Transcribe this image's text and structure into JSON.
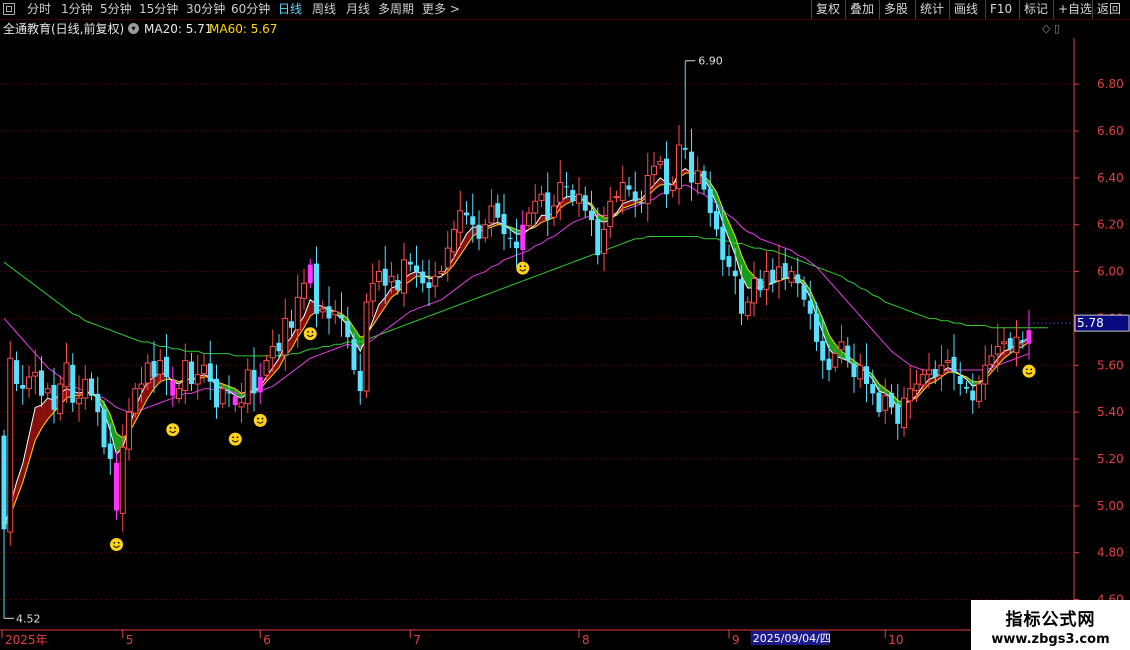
{
  "toolbar": {
    "periods": [
      "分时",
      "1分钟",
      "5分钟",
      "15分钟",
      "30分钟",
      "60分钟",
      "日线",
      "周线",
      "月线",
      "多周期"
    ],
    "active_period": "日线",
    "more_label": "更多 >",
    "right_buttons": [
      "复权",
      "叠加",
      "多股",
      "统计",
      "画线",
      "F10",
      "标记",
      "+自选",
      "返回"
    ]
  },
  "info": {
    "title": "全通教育(日线,前复权)",
    "ma20_label": "MA20: 5.71",
    "ma60_label": "MA60: 5.67",
    "icons": "◇ ▯"
  },
  "colors": {
    "up": "#ff4d4d",
    "down": "#57e0ff",
    "signal": "#ff33ff",
    "ma_white": "#ffffff",
    "ma_yellow": "#ffd800",
    "ma_magenta": "#e83ce8",
    "ma_green": "#2ecc2e",
    "axis": "#e04040"
  },
  "chart_data": {
    "type": "candlestick",
    "y_ticks": [
      "6.80",
      "6.60",
      "6.40",
      "6.20",
      "6.00",
      "5.80",
      "5.60",
      "5.40",
      "5.20",
      "5.00",
      "4.80",
      "4.60"
    ],
    "ylim": [
      4.47,
      6.98
    ],
    "x_labels": [
      {
        "label": "2025年",
        "index": 0
      },
      {
        "label": "5",
        "index": 19
      },
      {
        "label": "6",
        "index": 41
      },
      {
        "label": "7",
        "index": 65
      },
      {
        "label": "8",
        "index": 92
      },
      {
        "label": "9",
        "index": 116
      },
      {
        "label": "10",
        "index": 141
      }
    ],
    "cursor_date": "2025/09/04/四",
    "cursor_index": 119,
    "current_price": "5.78",
    "high_marker": {
      "label": "6.90",
      "value": 6.9,
      "index": 109
    },
    "low_marker": {
      "label": "4.52",
      "value": 4.52,
      "index": 0
    },
    "closes": [
      4.9,
      5.63,
      5.52,
      5.5,
      5.55,
      5.57,
      5.47,
      5.5,
      5.41,
      5.52,
      5.61,
      5.44,
      5.46,
      5.54,
      5.47,
      5.4,
      5.25,
      5.2,
      4.98,
      5.25,
      5.4,
      5.5,
      5.52,
      5.61,
      5.55,
      5.62,
      5.55,
      5.47,
      5.5,
      5.62,
      5.52,
      5.56,
      5.6,
      5.53,
      5.42,
      5.5,
      5.48,
      5.43,
      5.44,
      5.58,
      5.48,
      5.55,
      5.62,
      5.68,
      5.66,
      5.8,
      5.76,
      5.89,
      5.95,
      6.03,
      5.82,
      5.84,
      5.8,
      5.83,
      5.8,
      5.72,
      5.58,
      5.49,
      5.87,
      5.95,
      6.0,
      5.94,
      5.98,
      5.92,
      6.05,
      6.03,
      6.0,
      5.95,
      5.93,
      5.98,
      6.0,
      6.1,
      6.18,
      6.26,
      6.24,
      6.2,
      6.14,
      6.2,
      6.28,
      6.23,
      6.16,
      6.14,
      6.1,
      6.2,
      6.25,
      6.3,
      6.33,
      6.22,
      6.28,
      6.38,
      6.36,
      6.3,
      6.33,
      6.26,
      6.22,
      6.07,
      6.18,
      6.3,
      6.32,
      6.38,
      6.35,
      6.3,
      6.29,
      6.41,
      6.45,
      6.47,
      6.33,
      6.37,
      6.54,
      6.52,
      6.38,
      6.43,
      6.35,
      6.25,
      6.18,
      6.05,
      6.02,
      5.98,
      5.82,
      5.87,
      5.97,
      5.92,
      6.0,
      5.95,
      6.02,
      5.97,
      6.0,
      5.95,
      5.88,
      5.82,
      5.7,
      5.62,
      5.58,
      5.65,
      5.7,
      5.62,
      5.55,
      5.6,
      5.52,
      5.48,
      5.4,
      5.47,
      5.42,
      5.35,
      5.46,
      5.5,
      5.52,
      5.56,
      5.58,
      5.55,
      5.6,
      5.62,
      5.57,
      5.52,
      5.5,
      5.45,
      5.52,
      5.6,
      5.64,
      5.68,
      5.7,
      5.67,
      5.72,
      5.7,
      5.75
    ],
    "signal_indices": [
      18,
      27,
      37,
      41,
      49,
      83,
      164
    ],
    "ma_white": [
      4.9,
      5.0,
      5.1,
      5.18,
      5.3,
      5.42,
      5.43,
      5.46,
      5.45,
      5.48,
      5.5,
      5.49,
      5.48,
      5.49,
      5.48,
      5.46,
      5.4,
      5.32,
      5.22,
      5.25,
      5.33,
      5.42,
      5.48,
      5.53,
      5.55,
      5.57,
      5.56,
      5.53,
      5.52,
      5.54,
      5.54,
      5.55,
      5.56,
      5.55,
      5.51,
      5.5,
      5.49,
      5.47,
      5.46,
      5.48,
      5.49,
      5.51,
      5.55,
      5.59,
      5.63,
      5.69,
      5.72,
      5.77,
      5.81,
      5.88,
      5.86,
      5.85,
      5.84,
      5.82,
      5.8,
      5.77,
      5.71,
      5.66,
      5.72,
      5.79,
      5.86,
      5.89,
      5.93,
      5.94,
      5.97,
      5.99,
      6.0,
      5.99,
      5.97,
      5.97,
      5.98,
      6.02,
      6.06,
      6.11,
      6.16,
      6.19,
      6.19,
      6.19,
      6.2,
      6.21,
      6.2,
      6.18,
      6.16,
      6.16,
      6.18,
      6.2,
      6.24,
      6.24,
      6.25,
      6.3,
      6.32,
      6.32,
      6.32,
      6.3,
      6.28,
      6.22,
      6.21,
      6.22,
      6.25,
      6.29,
      6.3,
      6.31,
      6.31,
      6.34,
      6.37,
      6.4,
      6.38,
      6.37,
      6.42,
      6.44,
      6.42,
      6.42,
      6.4,
      6.35,
      6.29,
      6.21,
      6.14,
      6.07,
      5.98,
      5.93,
      5.93,
      5.93,
      5.94,
      5.95,
      5.97,
      5.97,
      5.98,
      5.97,
      5.94,
      5.89,
      5.81,
      5.74,
      5.67,
      5.64,
      5.63,
      5.62,
      5.6,
      5.59,
      5.57,
      5.54,
      5.49,
      5.48,
      5.46,
      5.42,
      5.43,
      5.45,
      5.47,
      5.51,
      5.54,
      5.55,
      5.57,
      5.59,
      5.58,
      5.56,
      5.54,
      5.51,
      5.52,
      5.55,
      5.59,
      5.63,
      5.66,
      5.67,
      5.69,
      5.7,
      5.72
    ],
    "ma_yellow": [
      4.9,
      4.96,
      5.03,
      5.1,
      5.19,
      5.28,
      5.33,
      5.37,
      5.4,
      5.43,
      5.46,
      5.47,
      5.47,
      5.48,
      5.48,
      5.47,
      5.44,
      5.39,
      5.31,
      5.29,
      5.31,
      5.36,
      5.41,
      5.46,
      5.5,
      5.53,
      5.54,
      5.54,
      5.53,
      5.54,
      5.54,
      5.54,
      5.55,
      5.55,
      5.53,
      5.52,
      5.51,
      5.5,
      5.48,
      5.49,
      5.49,
      5.5,
      5.53,
      5.56,
      5.59,
      5.64,
      5.67,
      5.72,
      5.76,
      5.81,
      5.83,
      5.84,
      5.84,
      5.83,
      5.82,
      5.8,
      5.76,
      5.72,
      5.73,
      5.77,
      5.81,
      5.85,
      5.89,
      5.91,
      5.94,
      5.96,
      5.98,
      5.98,
      5.98,
      5.97,
      5.98,
      6.0,
      6.03,
      6.07,
      6.11,
      6.15,
      6.17,
      6.18,
      6.19,
      6.2,
      6.2,
      6.19,
      6.18,
      6.17,
      6.18,
      6.19,
      6.21,
      6.22,
      6.23,
      6.27,
      6.29,
      6.3,
      6.31,
      6.3,
      6.29,
      6.25,
      6.23,
      6.23,
      6.24,
      6.27,
      6.28,
      6.29,
      6.3,
      6.32,
      6.35,
      6.37,
      6.37,
      6.37,
      6.4,
      6.42,
      6.42,
      6.42,
      6.41,
      6.38,
      6.34,
      6.27,
      6.21,
      6.15,
      6.07,
      6.01,
      5.98,
      5.96,
      5.95,
      5.95,
      5.96,
      5.97,
      5.97,
      5.97,
      5.96,
      5.92,
      5.86,
      5.8,
      5.73,
      5.69,
      5.66,
      5.64,
      5.62,
      5.6,
      5.58,
      5.56,
      5.52,
      5.5,
      5.48,
      5.45,
      5.44,
      5.45,
      5.46,
      5.49,
      5.52,
      5.53,
      5.55,
      5.57,
      5.57,
      5.56,
      5.55,
      5.53,
      5.53,
      5.54,
      5.57,
      5.6,
      5.63,
      5.65,
      5.67,
      5.68,
      5.7
    ],
    "ma_magenta": [
      5.8,
      5.77,
      5.74,
      5.71,
      5.68,
      5.65,
      5.62,
      5.59,
      5.57,
      5.55,
      5.53,
      5.51,
      5.5,
      5.49,
      5.48,
      5.47,
      5.46,
      5.44,
      5.42,
      5.41,
      5.4,
      5.41,
      5.41,
      5.42,
      5.43,
      5.44,
      5.45,
      5.46,
      5.47,
      5.48,
      5.48,
      5.49,
      5.5,
      5.5,
      5.49,
      5.49,
      5.49,
      5.48,
      5.48,
      5.48,
      5.49,
      5.49,
      5.5,
      5.51,
      5.53,
      5.55,
      5.57,
      5.59,
      5.61,
      5.63,
      5.64,
      5.65,
      5.66,
      5.67,
      5.68,
      5.69,
      5.68,
      5.68,
      5.69,
      5.71,
      5.73,
      5.75,
      5.77,
      5.79,
      5.81,
      5.83,
      5.84,
      5.85,
      5.86,
      5.87,
      5.88,
      5.9,
      5.92,
      5.94,
      5.96,
      5.98,
      5.99,
      6.0,
      6.02,
      6.03,
      6.05,
      6.06,
      6.07,
      6.08,
      6.09,
      6.11,
      6.12,
      6.14,
      6.15,
      6.17,
      6.19,
      6.21,
      6.22,
      6.23,
      6.24,
      6.24,
      6.24,
      6.24,
      6.25,
      6.26,
      6.27,
      6.28,
      6.29,
      6.3,
      6.31,
      6.33,
      6.34,
      6.35,
      6.36,
      6.37,
      6.36,
      6.34,
      6.33,
      6.31,
      6.29,
      6.26,
      6.24,
      6.22,
      6.19,
      6.17,
      6.16,
      6.14,
      6.13,
      6.12,
      6.11,
      6.1,
      6.09,
      6.07,
      6.06,
      6.04,
      6.02,
      5.99,
      5.96,
      5.93,
      5.9,
      5.87,
      5.84,
      5.81,
      5.78,
      5.75,
      5.72,
      5.69,
      5.66,
      5.64,
      5.62,
      5.6,
      5.59,
      5.58,
      5.58,
      5.58,
      5.58,
      5.58,
      5.58,
      5.58,
      5.58,
      5.58,
      5.58,
      5.58,
      5.59,
      5.6,
      5.61,
      5.62,
      5.63,
      5.64,
      5.65
    ],
    "ma_green": [
      6.04,
      6.02,
      6.0,
      5.98,
      5.96,
      5.94,
      5.92,
      5.9,
      5.88,
      5.86,
      5.84,
      5.82,
      5.81,
      5.79,
      5.78,
      5.77,
      5.76,
      5.75,
      5.74,
      5.73,
      5.72,
      5.71,
      5.7,
      5.7,
      5.69,
      5.68,
      5.68,
      5.67,
      5.67,
      5.66,
      5.66,
      5.66,
      5.65,
      5.65,
      5.65,
      5.65,
      5.65,
      5.64,
      5.64,
      5.64,
      5.64,
      5.64,
      5.64,
      5.64,
      5.64,
      5.64,
      5.65,
      5.65,
      5.66,
      5.67,
      5.67,
      5.68,
      5.68,
      5.69,
      5.69,
      5.7,
      5.7,
      5.7,
      5.71,
      5.72,
      5.73,
      5.74,
      5.75,
      5.76,
      5.77,
      5.78,
      5.79,
      5.8,
      5.81,
      5.82,
      5.83,
      5.84,
      5.85,
      5.86,
      5.87,
      5.88,
      5.89,
      5.9,
      5.91,
      5.92,
      5.93,
      5.94,
      5.95,
      5.96,
      5.97,
      5.98,
      5.99,
      6.0,
      6.01,
      6.02,
      6.03,
      6.04,
      6.05,
      6.06,
      6.07,
      6.08,
      6.09,
      6.1,
      6.11,
      6.12,
      6.13,
      6.14,
      6.14,
      6.15,
      6.15,
      6.15,
      6.15,
      6.15,
      6.15,
      6.15,
      6.15,
      6.15,
      6.14,
      6.14,
      6.14,
      6.13,
      6.13,
      6.12,
      6.12,
      6.11,
      6.1,
      6.1,
      6.09,
      6.09,
      6.08,
      6.07,
      6.06,
      6.05,
      6.04,
      6.03,
      6.02,
      6.01,
      6.0,
      5.99,
      5.98,
      5.96,
      5.95,
      5.93,
      5.92,
      5.9,
      5.89,
      5.87,
      5.86,
      5.85,
      5.84,
      5.83,
      5.82,
      5.81,
      5.8,
      5.8,
      5.79,
      5.79,
      5.78,
      5.78,
      5.77,
      5.77,
      5.77,
      5.77,
      5.76,
      5.76,
      5.76,
      5.76,
      5.76,
      5.76,
      5.76,
      5.76,
      5.76,
      5.76
    ]
  },
  "watermark": {
    "line1": "指标公式网",
    "line2": "www.zbgs3.com"
  }
}
